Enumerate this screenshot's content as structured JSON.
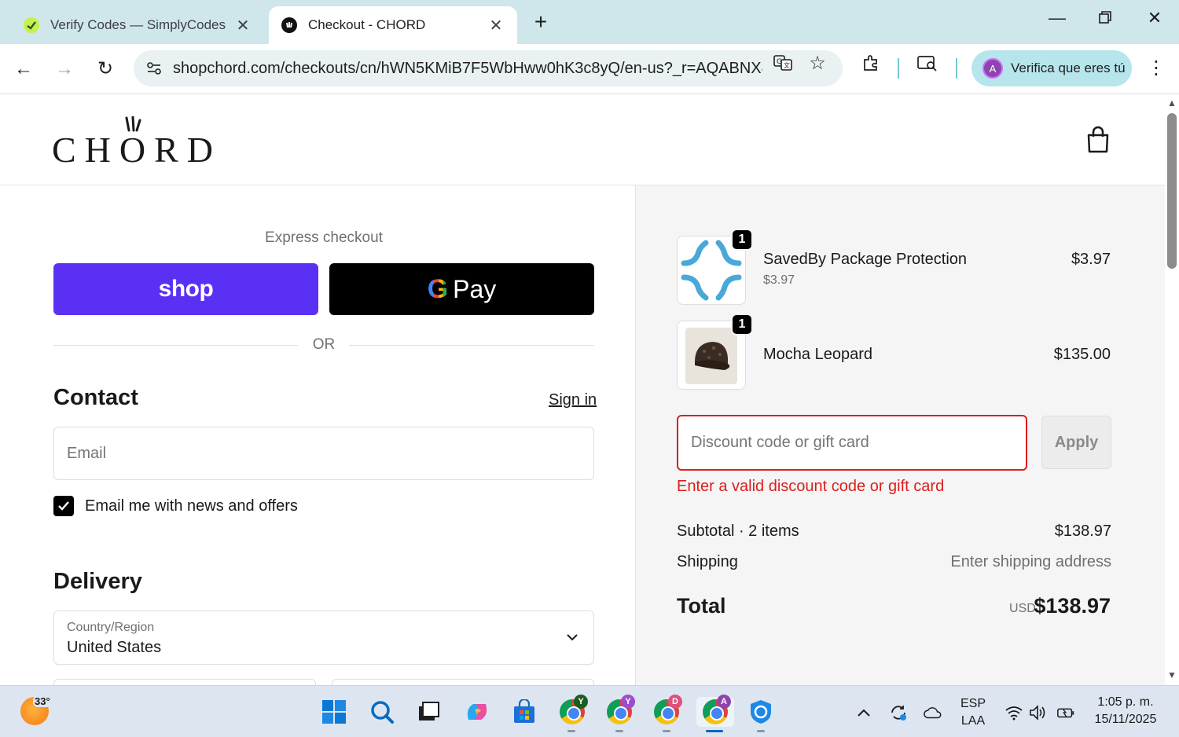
{
  "browser": {
    "tabs": [
      {
        "title": "Verify Codes — SimplyCodes",
        "active": false
      },
      {
        "title": "Checkout - CHORD",
        "active": true
      }
    ],
    "url": "shopchord.com/checkouts/cn/hWN5KMiB7F5WbHww0hK3c8yQ/en-us?_r=AQABNX8u...",
    "profile_label": "Verifica que eres tú",
    "profile_initial": "A"
  },
  "header": {
    "logo_text": "CHORD"
  },
  "checkout": {
    "express_label": "Express checkout",
    "shop_pay_label": "shop",
    "gpay_label": "Pay",
    "gpay_g": "G",
    "or_label": "OR",
    "contact_heading": "Contact",
    "sign_in_label": "Sign in",
    "email_placeholder": "Email",
    "news_checkbox_label": "Email me with news and offers",
    "news_checked": true,
    "delivery_heading": "Delivery",
    "country_label": "Country/Region",
    "country_value": "United States"
  },
  "summary": {
    "items": [
      {
        "name": "SavedBy Package Protection",
        "sub": "$3.97",
        "price": "$3.97",
        "qty": "1"
      },
      {
        "name": "Mocha Leopard",
        "sub": "",
        "price": "$135.00",
        "qty": "1"
      }
    ],
    "discount_placeholder": "Discount code or gift card",
    "apply_label": "Apply",
    "discount_error": "Enter a valid discount code or gift card",
    "subtotal_label": "Subtotal · 2 items",
    "subtotal_value": "$138.97",
    "shipping_label": "Shipping",
    "shipping_value": "Enter shipping address",
    "total_label": "Total",
    "total_currency": "USD",
    "total_value": "$138.97"
  },
  "taskbar": {
    "temperature": "33°",
    "language_top": "ESP",
    "language_bottom": "LAA",
    "time": "1:05 p. m.",
    "date": "15/11/2025",
    "chrome_profiles": [
      "Y",
      "Y",
      "D",
      "A"
    ]
  },
  "colors": {
    "shop_pay": "#5a31f4",
    "error": "#dd1d1d",
    "tab_strip": "#cfe6ea",
    "profile_pill": "#b6e5ec"
  }
}
